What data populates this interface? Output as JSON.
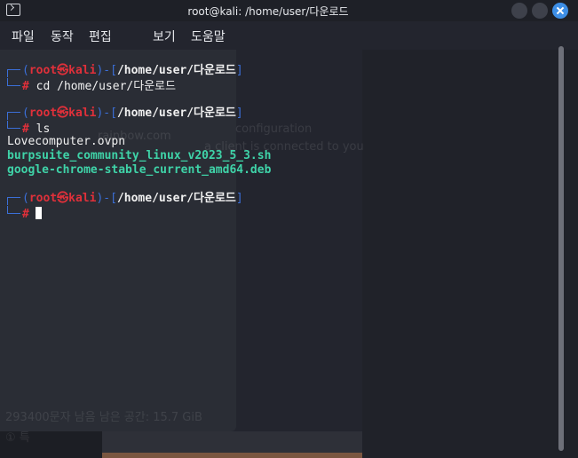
{
  "window": {
    "title": "root@kali: /home/user/다운로드"
  },
  "menu": {
    "items": [
      "파일",
      "동작",
      "편집",
      "보기",
      "도움말"
    ]
  },
  "terminal": {
    "prompts": [
      {
        "user": "root",
        "host": "kali",
        "skull": "㉿",
        "path": "/home/user/다운로드",
        "command": "cd /home/user/다운로드"
      },
      {
        "user": "root",
        "host": "kali",
        "skull": "㉿",
        "path": "/home/user/다운로드",
        "command": "ls"
      },
      {
        "user": "root",
        "host": "kali",
        "skull": "㉿",
        "path": "/home/user/다운로드",
        "command": ""
      }
    ],
    "ls_output": [
      "Lovecomputer.ovpn",
      "burpsuite_community_linux_v2023_5_3.sh",
      "google-chrome-stable_current_amd64.deb"
    ],
    "prompt_symbol": "#"
  },
  "ghost": {
    "texts": [
      "configuration",
      "a client is connected to you",
      "rainbow.com",
      "293400문자 남음 남은 공간: 15.7 GiB",
      "① 특"
    ]
  },
  "colors": {
    "prompt_frame": "#3b6fd8",
    "prompt_user": "#e0303a",
    "executable": "#3fd3a8",
    "close_button": "#3d8ee6"
  }
}
